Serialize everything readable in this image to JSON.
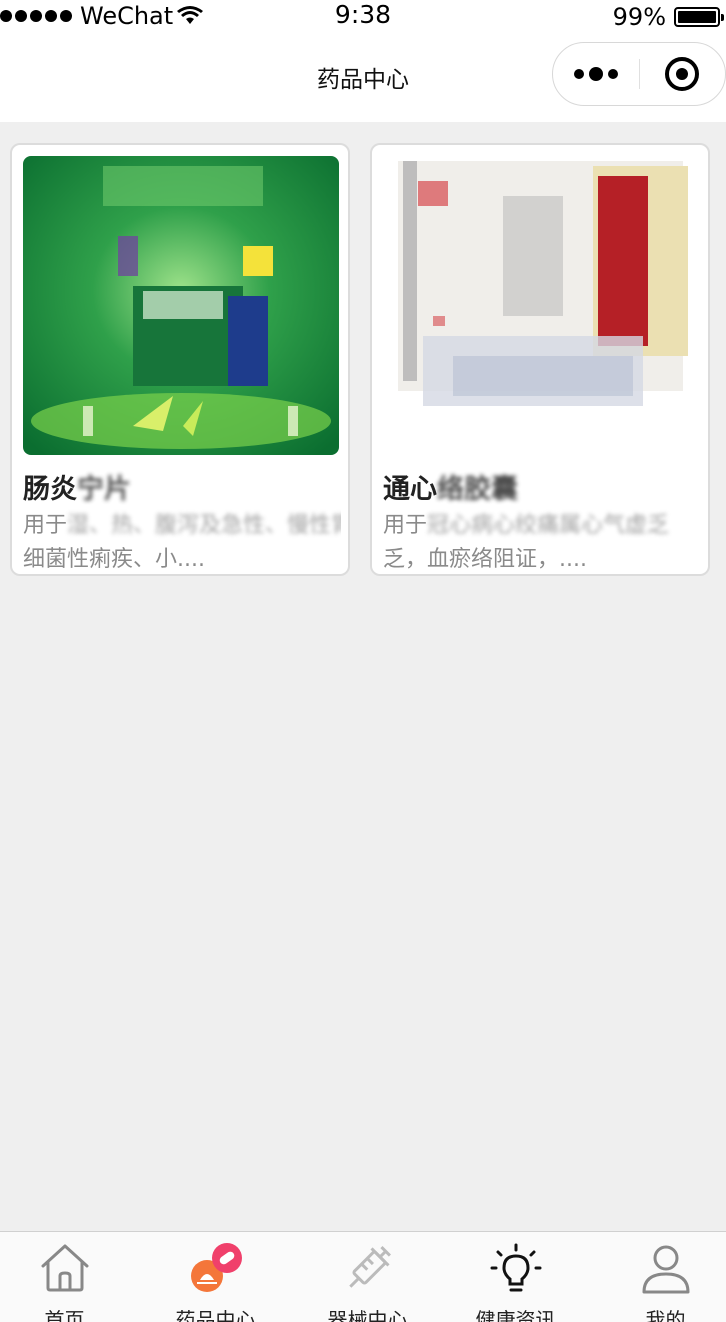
{
  "status_bar": {
    "carrier": "WeChat",
    "time": "9:38",
    "battery": "99%",
    "battery_level": 0.99
  },
  "nav": {
    "title": "药品中心"
  },
  "products": [
    {
      "name": "肠炎",
      "name_rest": "宁片",
      "desc_prefix": "用于",
      "desc_blur": "湿、热、腹泻及急性、慢性胃肠炎、",
      "desc_line2": "细菌性痢疾、小....",
      "image_colors": [
        "#0b7a36",
        "#2fa04a",
        "#83cf6b"
      ]
    },
    {
      "name": "通心",
      "name_rest": "络胶囊",
      "desc_prefix": "用于",
      "desc_blur": "冠心病心绞痛属心气虚乏",
      "desc_line2": "乏，血瘀络阻证，....",
      "image_colors": [
        "#f2f2f2",
        "#b8242a",
        "#e9e0b8"
      ]
    }
  ],
  "tabs": [
    {
      "label": "首页",
      "icon": "home-icon",
      "active": false
    },
    {
      "label": "药品中心",
      "icon": "pill-icon",
      "active": true
    },
    {
      "label": "器械中心",
      "icon": "syringe-icon",
      "active": false
    },
    {
      "label": "健康资讯",
      "icon": "lightbulb-icon",
      "active": false
    },
    {
      "label": "我的",
      "icon": "user-icon",
      "active": false
    }
  ],
  "colors": {
    "active_accent": "#f4763a",
    "badge": "#f0406b"
  }
}
